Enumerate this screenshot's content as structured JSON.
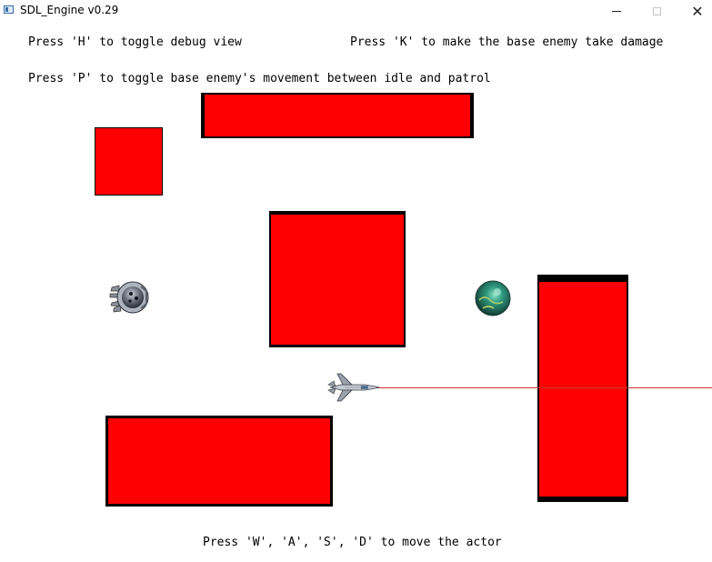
{
  "window": {
    "title": "SDL_Engine v0.29",
    "controls": {
      "minimize": "minimize",
      "maximize": "maximize",
      "close": "✕"
    }
  },
  "instructions": {
    "debug": "Press 'H' to toggle debug view",
    "damage": "Press 'K' to make the base enemy take damage",
    "patrol": "Press 'P' to toggle base enemy's movement between idle and patrol",
    "move": "Press 'W', 'A', 'S', 'D' to move the actor"
  },
  "colors": {
    "obstacle": "#ff0000",
    "outline": "#000000",
    "laser": "#d2332f",
    "background": "#ffffff"
  },
  "sprites": {
    "player": "fighter-jet-icon",
    "base_enemy": "armored-pod-icon",
    "orb_enemy": "green-orb-icon"
  }
}
